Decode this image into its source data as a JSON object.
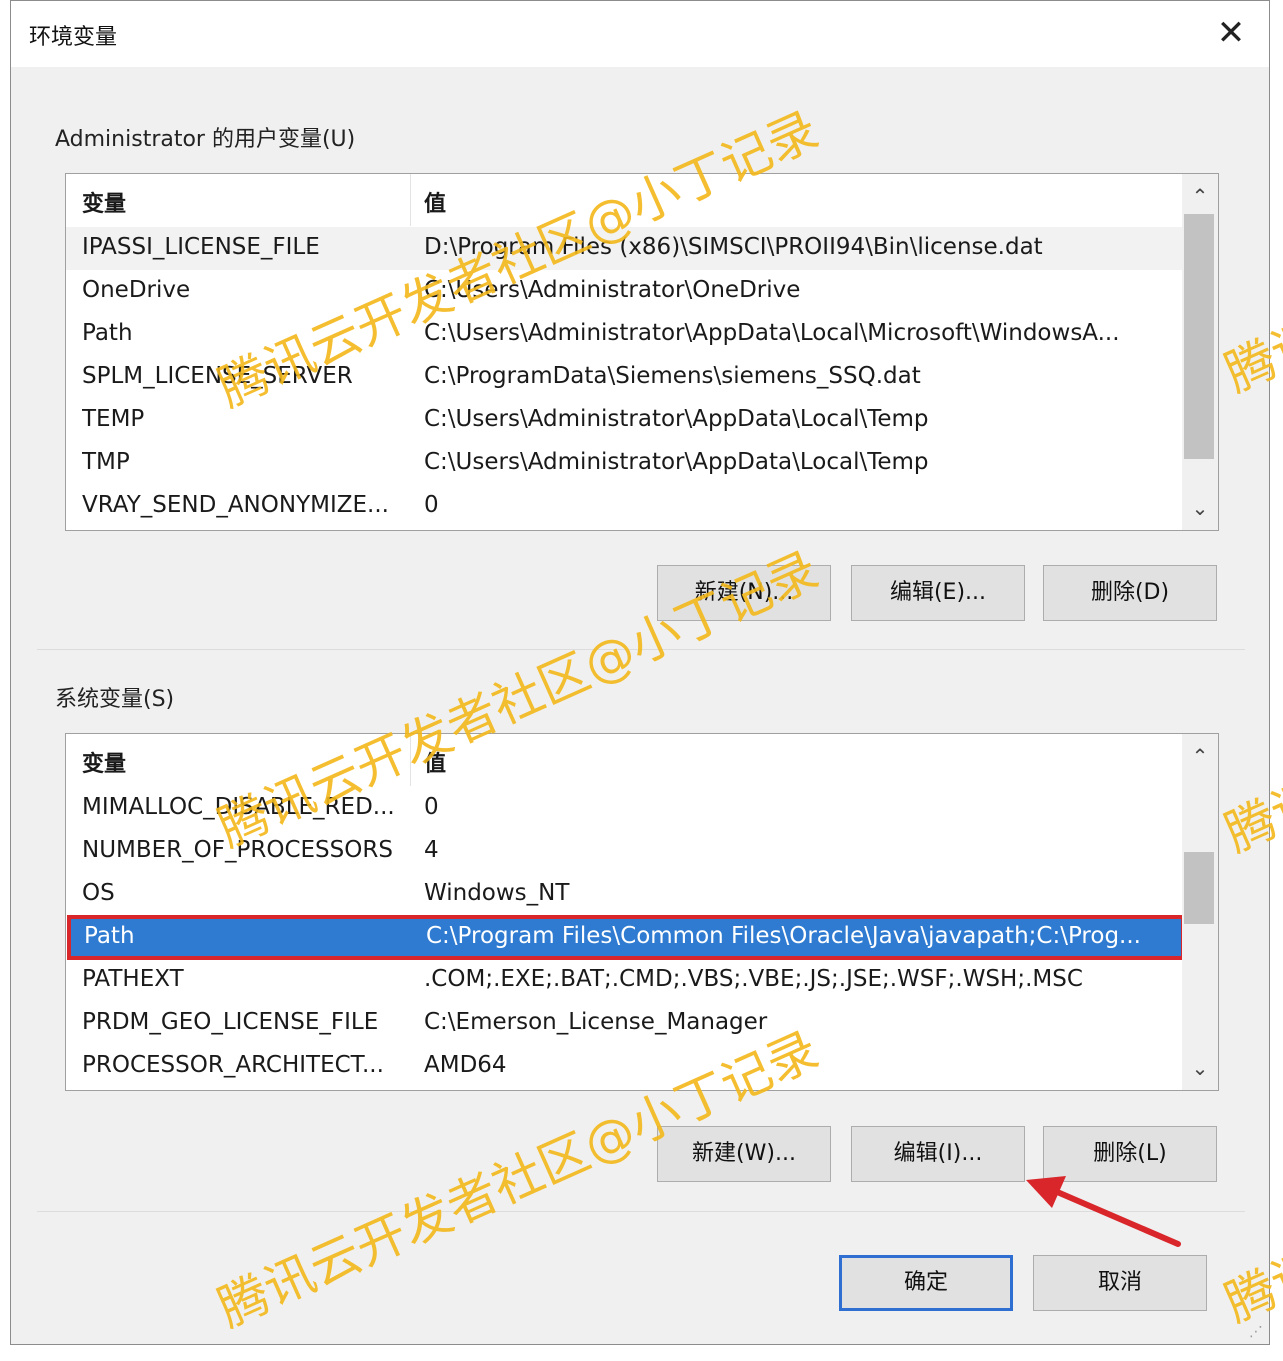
{
  "window": {
    "title": "环境变量",
    "close_glyph": "✕"
  },
  "user_vars": {
    "label": "Administrator 的用户变量(U)",
    "header": {
      "variable": "变量",
      "value": "值"
    },
    "rows": [
      {
        "name": "IPASSI_LICENSE_FILE",
        "value": "D:\\Program Files (x86)\\SIMSCI\\PROII94\\Bin\\license.dat"
      },
      {
        "name": "OneDrive",
        "value": "C:\\Users\\Administrator\\OneDrive"
      },
      {
        "name": "Path",
        "value": "C:\\Users\\Administrator\\AppData\\Local\\Microsoft\\WindowsA..."
      },
      {
        "name": "SPLM_LICENSE_SERVER",
        "value": "C:\\ProgramData\\Siemens\\siemens_SSQ.dat"
      },
      {
        "name": "TEMP",
        "value": "C:\\Users\\Administrator\\AppData\\Local\\Temp"
      },
      {
        "name": "TMP",
        "value": "C:\\Users\\Administrator\\AppData\\Local\\Temp"
      },
      {
        "name": "VRAY_SEND_ANONYMIZE...",
        "value": "0"
      }
    ],
    "buttons": {
      "new": "新建(N)...",
      "edit": "编辑(E)...",
      "delete": "删除(D)"
    }
  },
  "system_vars": {
    "label": "系统变量(S)",
    "header": {
      "variable": "变量",
      "value": "值"
    },
    "rows": [
      {
        "name": "MIMALLOC_DISABLE_RED...",
        "value": "0"
      },
      {
        "name": "NUMBER_OF_PROCESSORS",
        "value": "4"
      },
      {
        "name": "OS",
        "value": "Windows_NT"
      },
      {
        "name": "Path",
        "value": "C:\\Program Files\\Common Files\\Oracle\\Java\\javapath;C:\\Prog..."
      },
      {
        "name": "PATHEXT",
        "value": ".COM;.EXE;.BAT;.CMD;.VBS;.VBE;.JS;.JSE;.WSF;.WSH;.MSC"
      },
      {
        "name": "PRDM_GEO_LICENSE_FILE",
        "value": "C:\\Emerson_License_Manager"
      },
      {
        "name": "PROCESSOR_ARCHITECT...",
        "value": "AMD64"
      }
    ],
    "selected_row": "Path",
    "buttons": {
      "new": "新建(W)...",
      "edit": "编辑(I)...",
      "delete": "删除(L)"
    }
  },
  "footer": {
    "ok": "确定",
    "cancel": "取消"
  },
  "watermark": "腾讯云开发者社区@小丁记录",
  "watermark_fragment": "腾讯",
  "scroll_glyphs": {
    "up": "⌃",
    "down": "⌄"
  },
  "colors": {
    "selection": "#2f7bd1",
    "highlight_border": "#d9262b",
    "watermark": "#f3b81a",
    "annotation_arrow": "#d9262b"
  }
}
